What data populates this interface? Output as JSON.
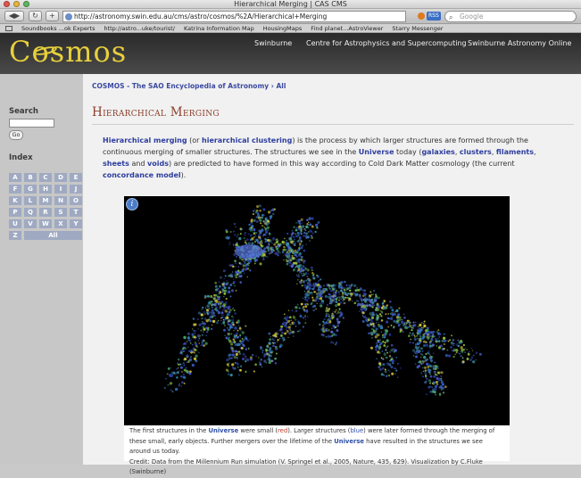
{
  "window": {
    "title": "Hierarchical Merging | CAS CMS"
  },
  "toolbar": {
    "back": "◀",
    "forward": "▶",
    "reload": "↻",
    "add": "+",
    "url": "http://astronomy.swin.edu.au/cms/astro/cosmos/%2A/Hierarchical+Merging",
    "rss": "RSS",
    "search_placeholder": "Google"
  },
  "bookmarks": [
    "Soundbooks ...ok Experts",
    "http://astro...uke/tourist/",
    "Katrina Information Map",
    "HousingMaps",
    "Find planet...AstroViewer",
    "Starry Messenger"
  ],
  "site": {
    "logo": "Cosmos",
    "nav": [
      "Swinburne",
      "Centre for Astrophysics and Supercomputing",
      "Swinburne Astronomy Online"
    ]
  },
  "sidebar": {
    "search_heading": "Search",
    "go_label": "Go",
    "index_heading": "Index",
    "letters": [
      "A",
      "B",
      "C",
      "D",
      "E",
      "F",
      "G",
      "H",
      "I",
      "J",
      "K",
      "L",
      "M",
      "N",
      "O",
      "P",
      "Q",
      "R",
      "S",
      "T",
      "U",
      "V",
      "W",
      "X",
      "Y",
      "Z"
    ],
    "all_label": "All"
  },
  "content": {
    "breadcrumb": "COSMOS - The SAO Encyclopedia of Astronomy › All",
    "title": "Hierarchical Merging",
    "intro": {
      "t1": "Hierarchical merging",
      "t2": " (or ",
      "t3": "hierarchical clustering",
      "t4": ") is the process by which larger structures are formed through the continuous merging of smaller structures. The structures we see in the ",
      "t5": "Universe",
      "t6": " today (",
      "t7": "galaxies",
      "t8": ", ",
      "t9": "clusters",
      "t10": ", ",
      "t11": "filaments",
      "t12": ", ",
      "t13": "sheets",
      "t14": " and ",
      "t15": "voids",
      "t16": ") are predicted to have formed in this way according to Cold Dark Matter cosmology (the current ",
      "t17": "concordance model",
      "t18": ")."
    },
    "figure_info_icon": "i",
    "caption": {
      "c1": "The first structures in the ",
      "c2": "Universe",
      "c3": " were small (",
      "c4": "red",
      "c5": "). Larger structures (",
      "c6": "blue",
      "c7": ") were later formed through the merging of these small, early objects. Further mergers over the lifetime of the ",
      "c8": "Universe",
      "c9": " have resulted in the structures we see around us today.",
      "credit": "Credit: Data from the Millennium Run simulation (V. Springel et al., 2005, Nature, 435, 629). Visualization by C.Fluke (Swinburne)"
    }
  },
  "colors": {
    "logo": "#e7cf3c",
    "link": "#2d3d9d",
    "title": "#8b3e2a",
    "index_tile": "#9faac2"
  }
}
